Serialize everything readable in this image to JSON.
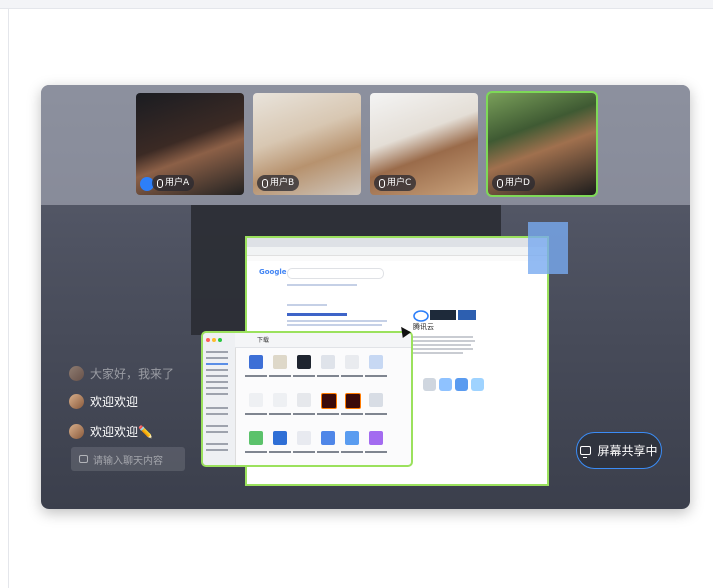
{
  "participants": [
    {
      "label": "用户A",
      "speaking": false,
      "host": true
    },
    {
      "label": "用户B",
      "speaking": false,
      "host": false
    },
    {
      "label": "用户C",
      "speaking": false,
      "host": false
    },
    {
      "label": "用户D",
      "speaking": true,
      "host": false
    }
  ],
  "shared_screen": {
    "google_label": "Google",
    "tencent_name": "腾讯云",
    "finder_title": "下载"
  },
  "chat": {
    "messages": [
      {
        "text": "大家好，我来了",
        "faded": true
      },
      {
        "text": "欢迎欢迎",
        "faded": false
      },
      {
        "text": "欢迎欢迎✏️",
        "faded": false
      }
    ],
    "input_placeholder": "请输入聊天内容"
  },
  "share_button": {
    "label": "屏幕共享中"
  },
  "colors": {
    "speaking_border": "#7ed957",
    "share_border": "#3b8cf5"
  }
}
